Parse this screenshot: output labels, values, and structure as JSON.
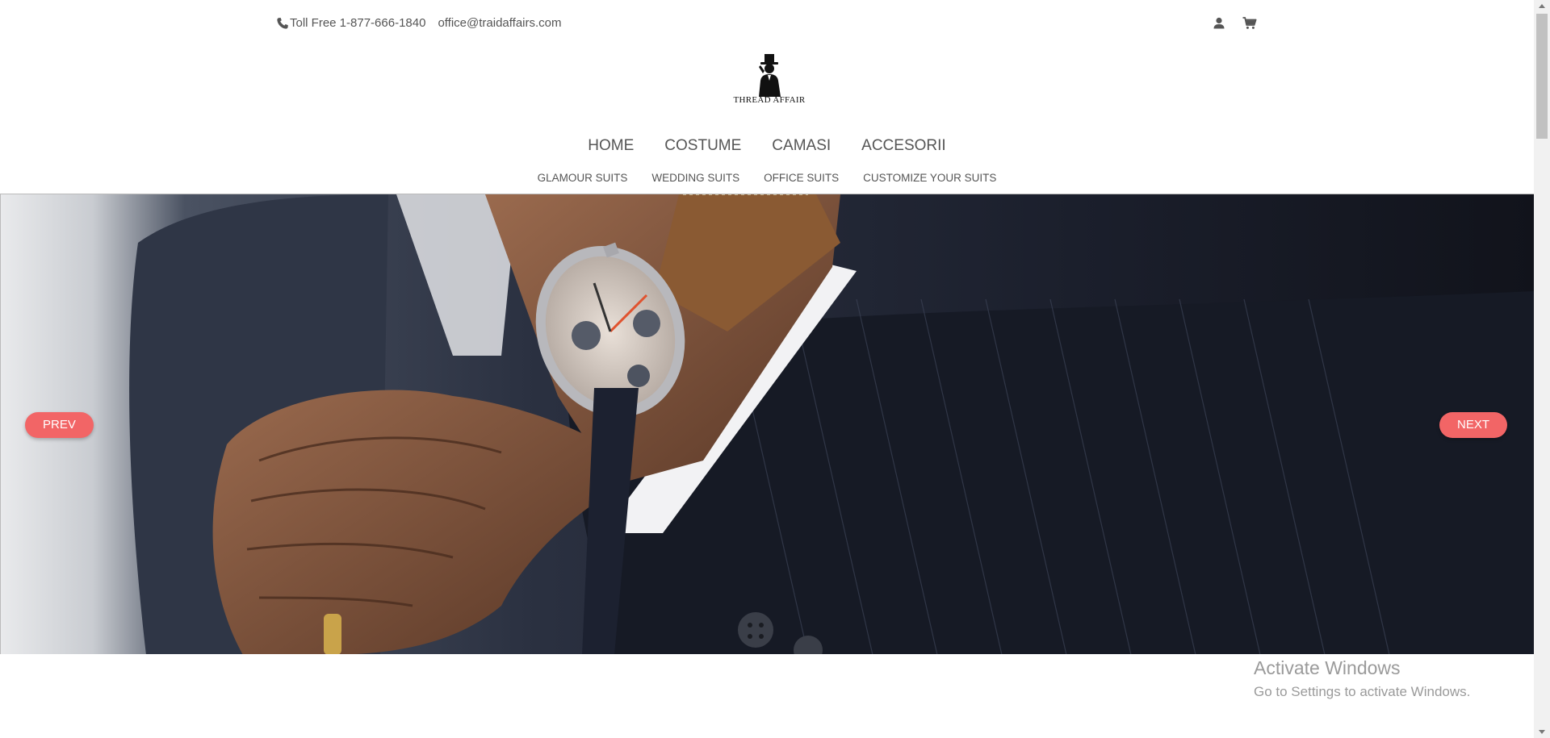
{
  "topbar": {
    "phone": "Toll Free 1-877-666-1840",
    "email": "office@traidaffairs.com"
  },
  "icons": {
    "phone": "phone-icon",
    "user": "user-icon",
    "cart": "cart-icon",
    "logo": "gentleman-logo-icon"
  },
  "logo": {
    "brand": "THREAD AFFAIR"
  },
  "main_nav": [
    "HOME",
    "COSTUME",
    "CAMASI",
    "ACCESORII"
  ],
  "sub_nav": [
    "GLAMOUR SUITS",
    "WEDDING SUITS",
    "OFFICE SUITS",
    "CUSTOMIZE YOUR SUITS"
  ],
  "slider": {
    "prev": "PREV",
    "next": "NEXT"
  },
  "watermark": {
    "title": "Activate Windows",
    "subtitle": "Go to Settings to activate Windows."
  },
  "colors": {
    "accent": "#f26566",
    "text": "#555555"
  }
}
